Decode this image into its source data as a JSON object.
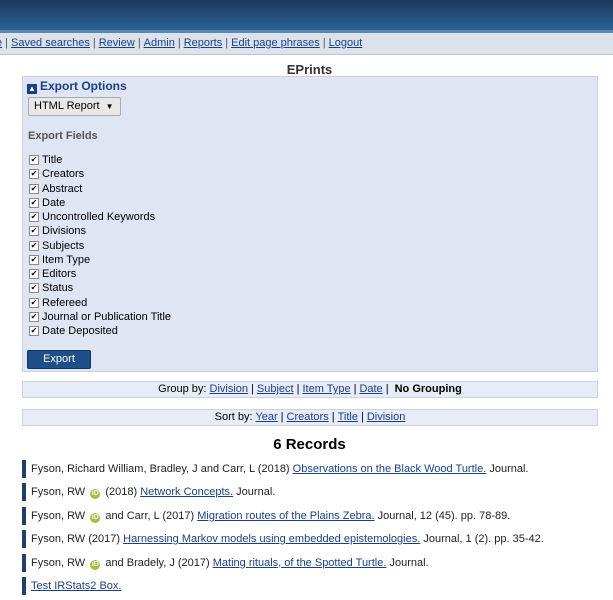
{
  "menu": {
    "items": [
      "e",
      "Saved searches",
      "Review",
      "Admin",
      "Reports",
      "Edit page phrases",
      "Logout"
    ]
  },
  "page_title": "EPrints",
  "export": {
    "header": "Export Options",
    "format": "HTML Report",
    "fields_heading": "Export Fields",
    "fields": [
      "Title",
      "Creators",
      "Abstract",
      "Date",
      "Uncontrolled Keywords",
      "Divisions",
      "Subjects",
      "Item Type",
      "Editors",
      "Status",
      "Refereed",
      "Journal or Publication Title",
      "Date Deposited"
    ],
    "button": "Export"
  },
  "group_by": {
    "label": "Group by:",
    "options": [
      "Division",
      "Subject",
      "Item Type",
      "Date"
    ],
    "selected": "No Grouping"
  },
  "sort_by": {
    "label": "Sort by:",
    "options": [
      "Year",
      "Creators",
      "Title",
      "Division"
    ]
  },
  "records_count": "6 Records",
  "results": [
    {
      "authors": "Fyson, Richard William, Bradley, J and Carr, L",
      "orcid": false,
      "coauthors": "",
      "year": "(2018)",
      "title": "Observations on the Black Wood Turtle.",
      "tail": "Journal."
    },
    {
      "authors": "Fyson, RW",
      "orcid": true,
      "coauthors": "",
      "year": "(2018)",
      "title": "Network Concepts.",
      "tail": "Journal."
    },
    {
      "authors": "Fyson, RW",
      "orcid": true,
      "coauthors": "and Carr, L",
      "year": "(2017)",
      "title": "Migration routes of the Plains Zebra.",
      "tail": "Journal, 12 (45). pp. 78-89."
    },
    {
      "authors": "Fyson, RW",
      "orcid": false,
      "coauthors": "",
      "year": "(2017)",
      "title": "Harnessing Markov models using embedded epistemologies.",
      "tail": "Journal, 1 (2). pp. 35-42."
    },
    {
      "authors": "Fyson, RW",
      "orcid": true,
      "coauthors": "and Bradely, J",
      "year": "(2017)",
      "title": "Mating rituals, of the Spotted Turtle.",
      "tail": "Journal."
    },
    {
      "authors": "",
      "orcid": false,
      "coauthors": "",
      "year": "",
      "title": "Test IRStats2 Box.",
      "tail": ""
    }
  ],
  "orcid_glyph": "iD",
  "checkbox_glyph": "✔",
  "toggle_glyph": "▲",
  "caret_glyph": "▼",
  "colors": {
    "banner": "#234f7c",
    "link": "#1a3f8a",
    "panel": "#dfe5f3",
    "button": "#1f4f8a",
    "orcid": "#9ac23c"
  }
}
